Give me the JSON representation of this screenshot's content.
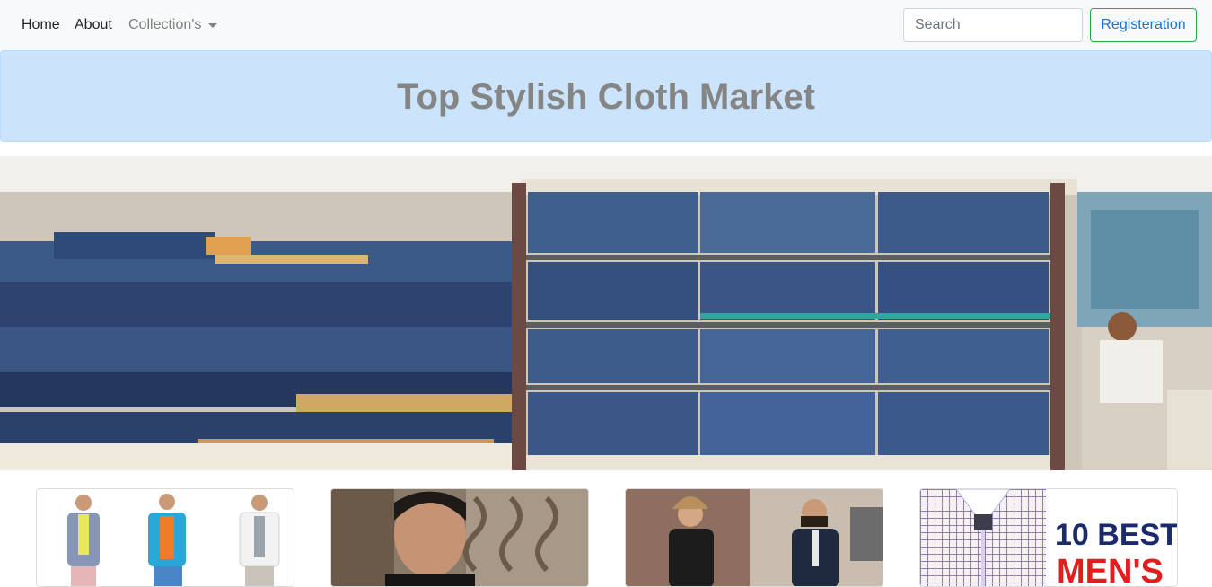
{
  "nav": {
    "home": "Home",
    "about": "About",
    "collections": "Collection's",
    "search_placeholder": "Search",
    "register": "Registeration"
  },
  "banner": {
    "title": "Top Stylish Cloth Market"
  },
  "hero": {
    "icon": "jeans-store-shelves-photo"
  },
  "cards": [
    {
      "icon": "men-casual-outfits-photo"
    },
    {
      "icon": "man-portrait-photo"
    },
    {
      "icon": "men-street-style-photo"
    },
    {
      "icon": "checked-shirt-photo",
      "caption_line1": "10 BEST",
      "caption_line2": "MEN'S"
    }
  ],
  "colors": {
    "navbar_bg": "#f8f9fa",
    "banner_bg": "#cce4fb",
    "banner_text": "#858585",
    "register_border": "#28a745",
    "register_text": "#1a73c9"
  }
}
